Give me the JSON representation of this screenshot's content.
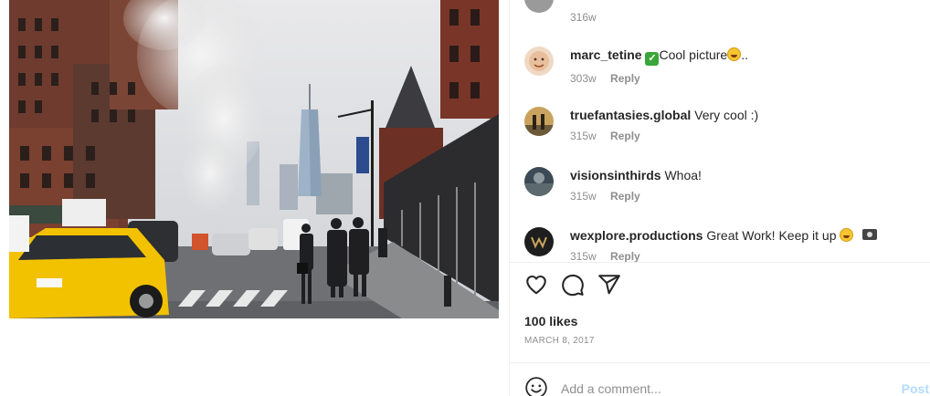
{
  "post": {
    "likes": "100 likes",
    "date": "MARCH 8, 2017"
  },
  "comments": {
    "top_time": "316w",
    "items": [
      {
        "username": "marc_tetine",
        "text": "Cool picture",
        "suffix": "..",
        "time": "303w",
        "reply": "Reply"
      },
      {
        "username": "truefantasies.global",
        "text": "Very cool :)",
        "time": "315w",
        "reply": "Reply"
      },
      {
        "username": "visionsinthirds",
        "text": "Whoa!",
        "time": "315w",
        "reply": "Reply"
      },
      {
        "username": "wexplore.productions",
        "text": "Great Work! Keep it up",
        "time": "315w",
        "reply": "Reply"
      }
    ]
  },
  "comment_box": {
    "placeholder": "Add a comment...",
    "post_label": "Post"
  },
  "colors": {
    "taxi": "#f2c200",
    "text": "#262626",
    "muted": "#8e8e8e",
    "post_button": "#b3dbff"
  },
  "icons": {
    "like": "heart-icon",
    "comment": "comment-bubble-icon",
    "share": "paper-plane-icon",
    "emoji": "smiley-icon"
  }
}
